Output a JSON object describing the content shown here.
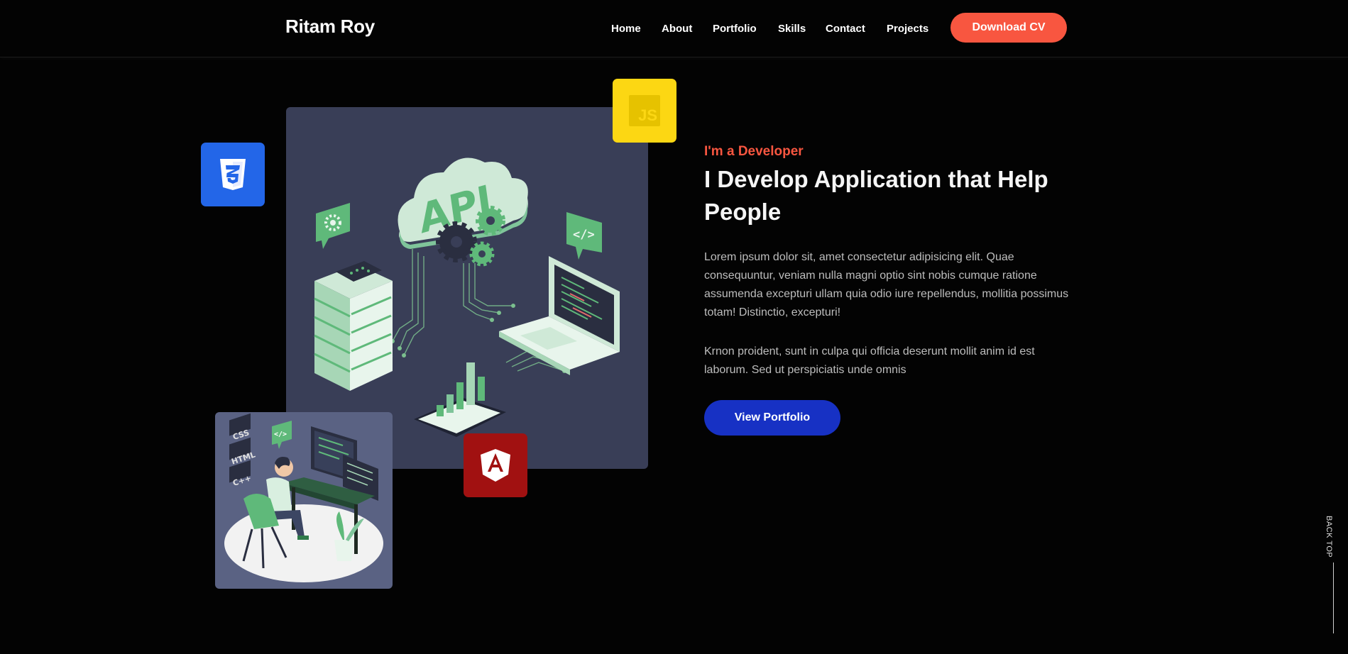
{
  "header": {
    "brand": "Ritam Roy",
    "nav": [
      {
        "label": "Home"
      },
      {
        "label": "About"
      },
      {
        "label": "Portfolio"
      },
      {
        "label": "Skills"
      },
      {
        "label": "Contact"
      },
      {
        "label": "Projects"
      }
    ],
    "cta_label": "Download CV"
  },
  "illustration": {
    "cloud_text": "API",
    "tiles": [
      {
        "name": "css3-icon",
        "color": "#2366e8"
      },
      {
        "name": "javascript-icon",
        "color": "#fcd713",
        "text": "JS"
      },
      {
        "name": "angular-icon",
        "color": "#a11111"
      }
    ],
    "skill_tags": [
      "CSS",
      "HTML",
      "C++"
    ]
  },
  "hero": {
    "eyebrow": "I'm a Developer",
    "headline": "I Develop Application that Help People",
    "paragraph1": "Lorem ipsum dolor sit, amet consectetur adipisicing elit. Quae consequuntur, veniam nulla magni optio sint nobis cumque ratione assumenda excepturi ullam quia odio iure repellendus, mollitia possimus totam! Distinctio, excepturi!",
    "paragraph2": "Krnon proident, sunt in culpa qui officia deserunt mollit anim id est laborum. Sed ut perspiciatis unde omnis",
    "button_label": "View Portfolio"
  },
  "back_top": {
    "label": "BACK TOP"
  },
  "colors": {
    "background": "#030303",
    "accent": "#f85640",
    "primary_button": "#1731c4",
    "illustration_bg": "#393e57",
    "illustration_green": "#5fb97a"
  }
}
